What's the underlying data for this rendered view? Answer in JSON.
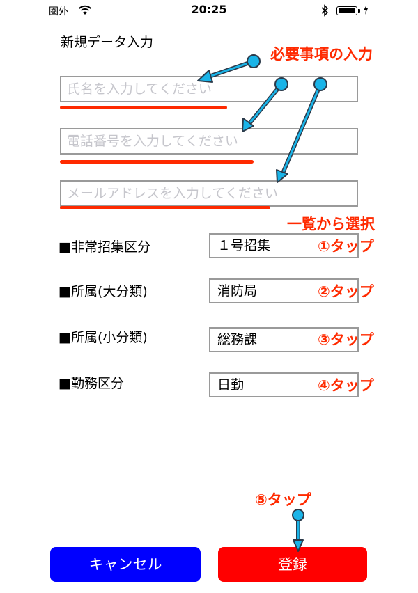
{
  "status_bar": {
    "carrier": "圏外",
    "time": "20:25"
  },
  "header": {
    "title": "新規データ入力"
  },
  "form": {
    "name_placeholder": "氏名を入力してください",
    "phone_placeholder": "電話番号を入力してください",
    "email_placeholder": "メールアドレスを入力してください"
  },
  "selects": [
    {
      "label": "■非常招集区分",
      "value": "１号招集"
    },
    {
      "label": "■所属(大分類)",
      "value": "消防局"
    },
    {
      "label": "■所属(小分類)",
      "value": "総務課"
    },
    {
      "label": "■勤務区分",
      "value": "日勤"
    }
  ],
  "annotations": {
    "required": "必要事項の入力",
    "select_from_list": "一覧から選択",
    "tap1": "①タップ",
    "tap2": "②タップ",
    "tap3": "③タップ",
    "tap4": "④タップ",
    "tap5": "⑤タップ"
  },
  "buttons": {
    "cancel": "キャンセル",
    "register": "登録"
  },
  "colors": {
    "annotation_red": "#ff2a00",
    "callout_cyan": "#1ab4e8",
    "cancel_blue": "#0000ff",
    "register_red": "#ff0000"
  },
  "icons": [
    "wifi-icon",
    "bluetooth-icon",
    "battery-icon",
    "charging-icon"
  ]
}
